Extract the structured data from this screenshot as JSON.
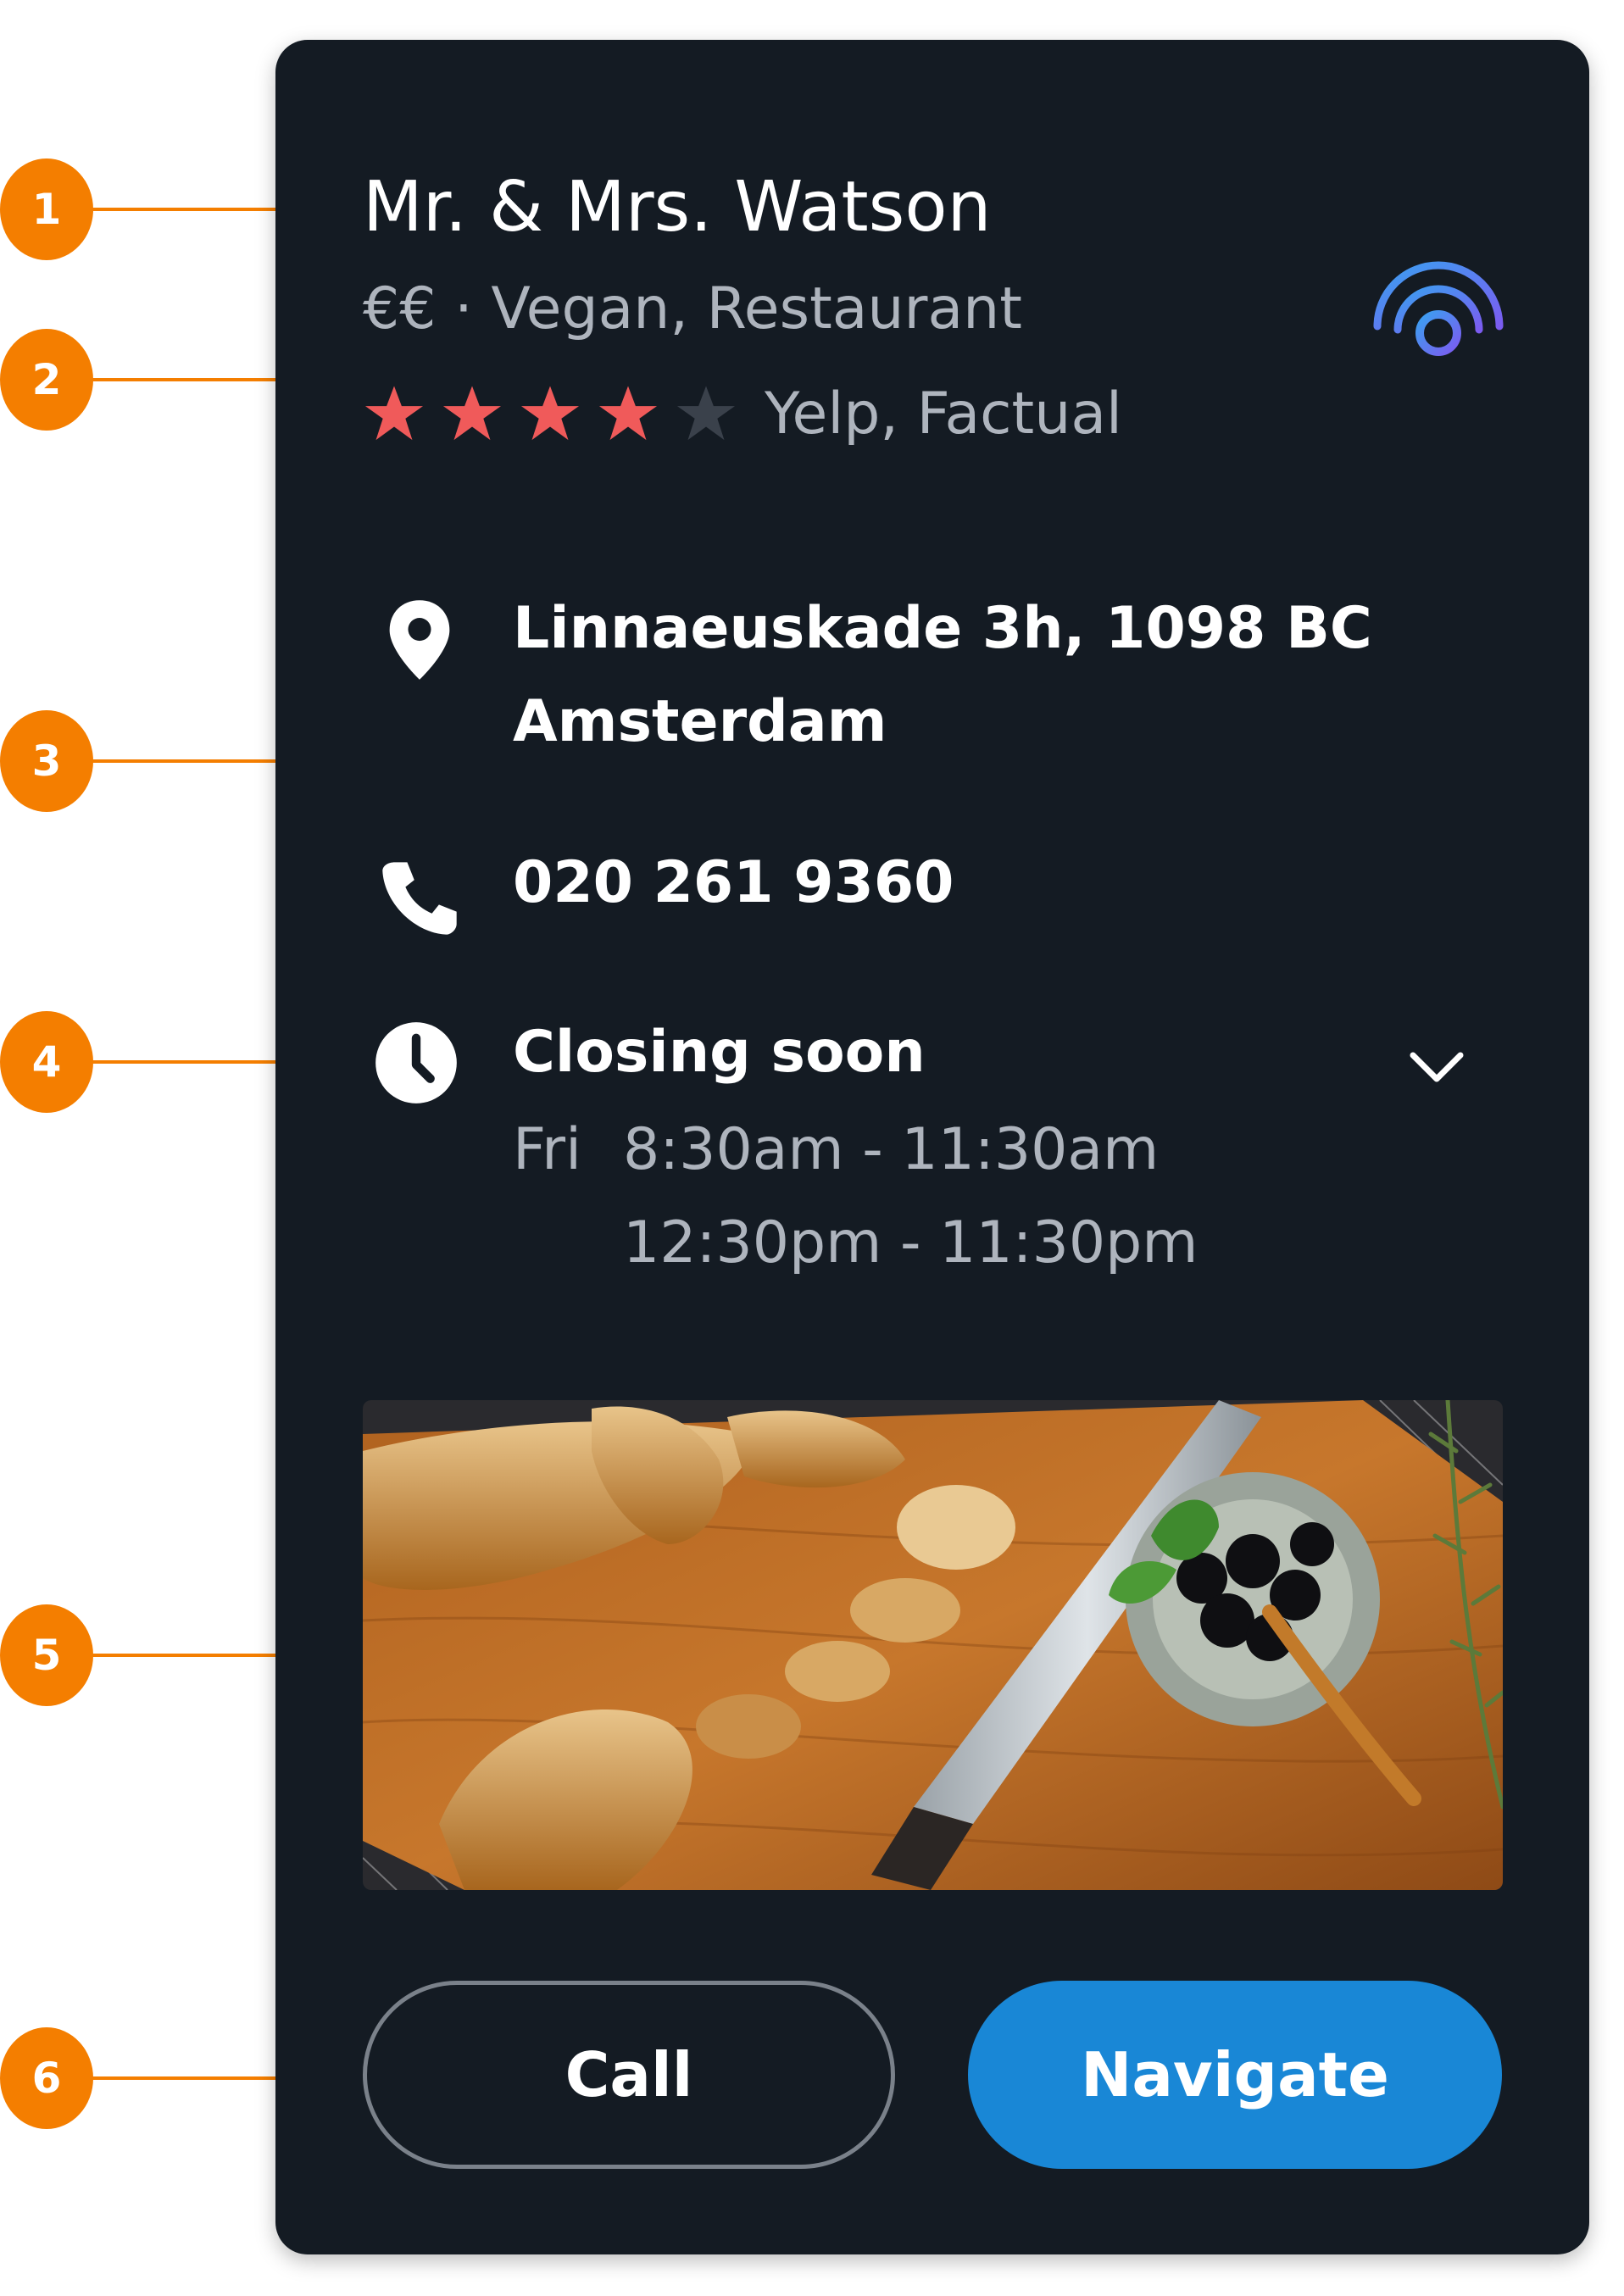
{
  "place": {
    "name": "Mr. & Mrs. Watson",
    "subtitle": "€€ · Vegan, Restaurant",
    "rating_value": 4,
    "rating_max": 5,
    "rating_sources": "Yelp, Factual"
  },
  "details": {
    "address_line1": "Linnaeuskade 3h, 1098 BC",
    "address_line2": "Amsterdam",
    "phone": "020 261 9360",
    "hours_status": "Closing soon",
    "hours_day": "Fri",
    "hours_range_1": "8:30am - 11:30am",
    "hours_range_2": "12:30pm - 11:30pm"
  },
  "actions": {
    "call_label": "Call",
    "navigate_label": "Navigate"
  },
  "callouts": [
    "1",
    "2",
    "3",
    "4",
    "5",
    "6"
  ],
  "icons": {
    "location": "location-pin-icon",
    "phone": "phone-icon",
    "clock": "clock-icon",
    "expand": "chevron-down-icon",
    "live": "live-signal-icon"
  },
  "colors": {
    "card_bg": "#141b23",
    "star_filled": "#f05a5a",
    "star_empty": "#3a414b",
    "accent_blue": "#1987d6",
    "callout_orange": "#f47e00"
  }
}
